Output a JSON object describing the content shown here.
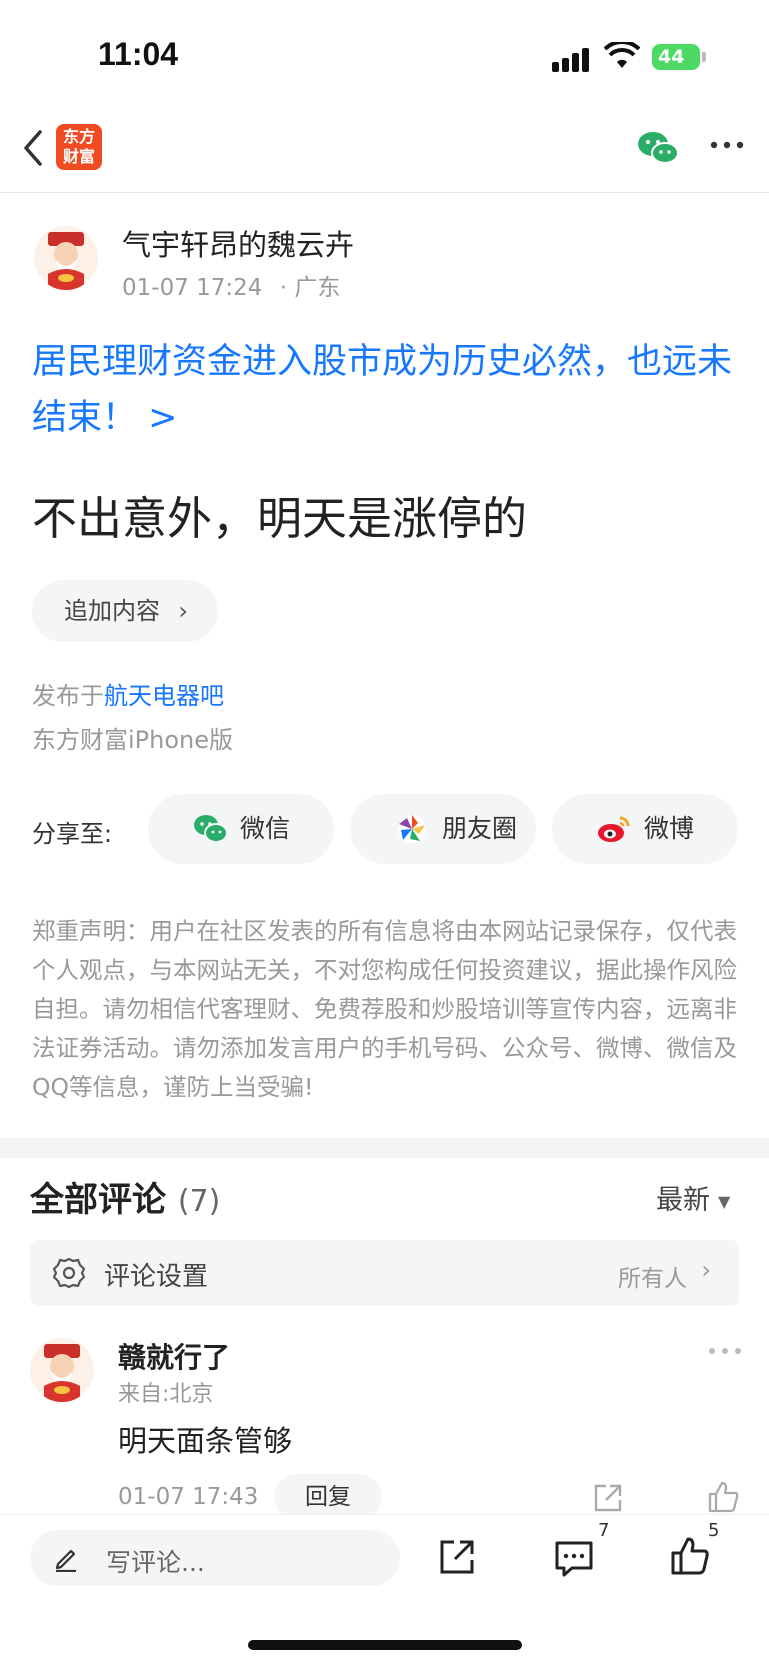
{
  "status_bar": {
    "time": "11:04",
    "battery": "44"
  },
  "nav": {
    "logo_text_line1": "东方",
    "logo_text_line2": "财富",
    "logo_color": "#f04b23"
  },
  "post": {
    "author": "气宇轩昂的魏云卉",
    "time": "01-07 17:24",
    "location": "· 广东",
    "title_link": "居民理财资金进入股市成为历史必然，也远未结束！ >",
    "body": "不出意外，明天是涨停的",
    "append_button": "追加内容",
    "posted_prefix": "发布于",
    "posted_bar": "航天电器吧",
    "client": "东方财富iPhone版"
  },
  "share": {
    "label": "分享至:",
    "options": [
      {
        "label": "微信",
        "icon": "wechat-icon"
      },
      {
        "label": "朋友圈",
        "icon": "moments-icon"
      },
      {
        "label": "微博",
        "icon": "weibo-icon"
      }
    ]
  },
  "disclaimer": "郑重声明：用户在社区发表的所有信息将由本网站记录保存，仅代表个人观点，与本网站无关，不对您构成任何投资建议，据此操作风险自担。请勿相信代客理财、免费荐股和炒股培训等宣传内容，远离非法证券活动。请勿添加发言用户的手机号码、公众号、微博、微信及QQ等信息，谨防上当受骗!",
  "comments": {
    "heading": "全部评论",
    "count": "(7)",
    "sort": "最新",
    "settings_label": "评论设置",
    "settings_value": "所有人",
    "items": [
      {
        "name": "赣就行了",
        "from": "来自:北京",
        "text": "明天面条管够",
        "time": "01-07 17:43",
        "reply": "回复"
      }
    ]
  },
  "bottom_bar": {
    "input_placeholder": "写评论...",
    "comment_count": "7",
    "like_count": "5"
  },
  "colors": {
    "link": "#1677ff",
    "accent_green": "#4cd964",
    "wechat_green": "#2aae67"
  }
}
